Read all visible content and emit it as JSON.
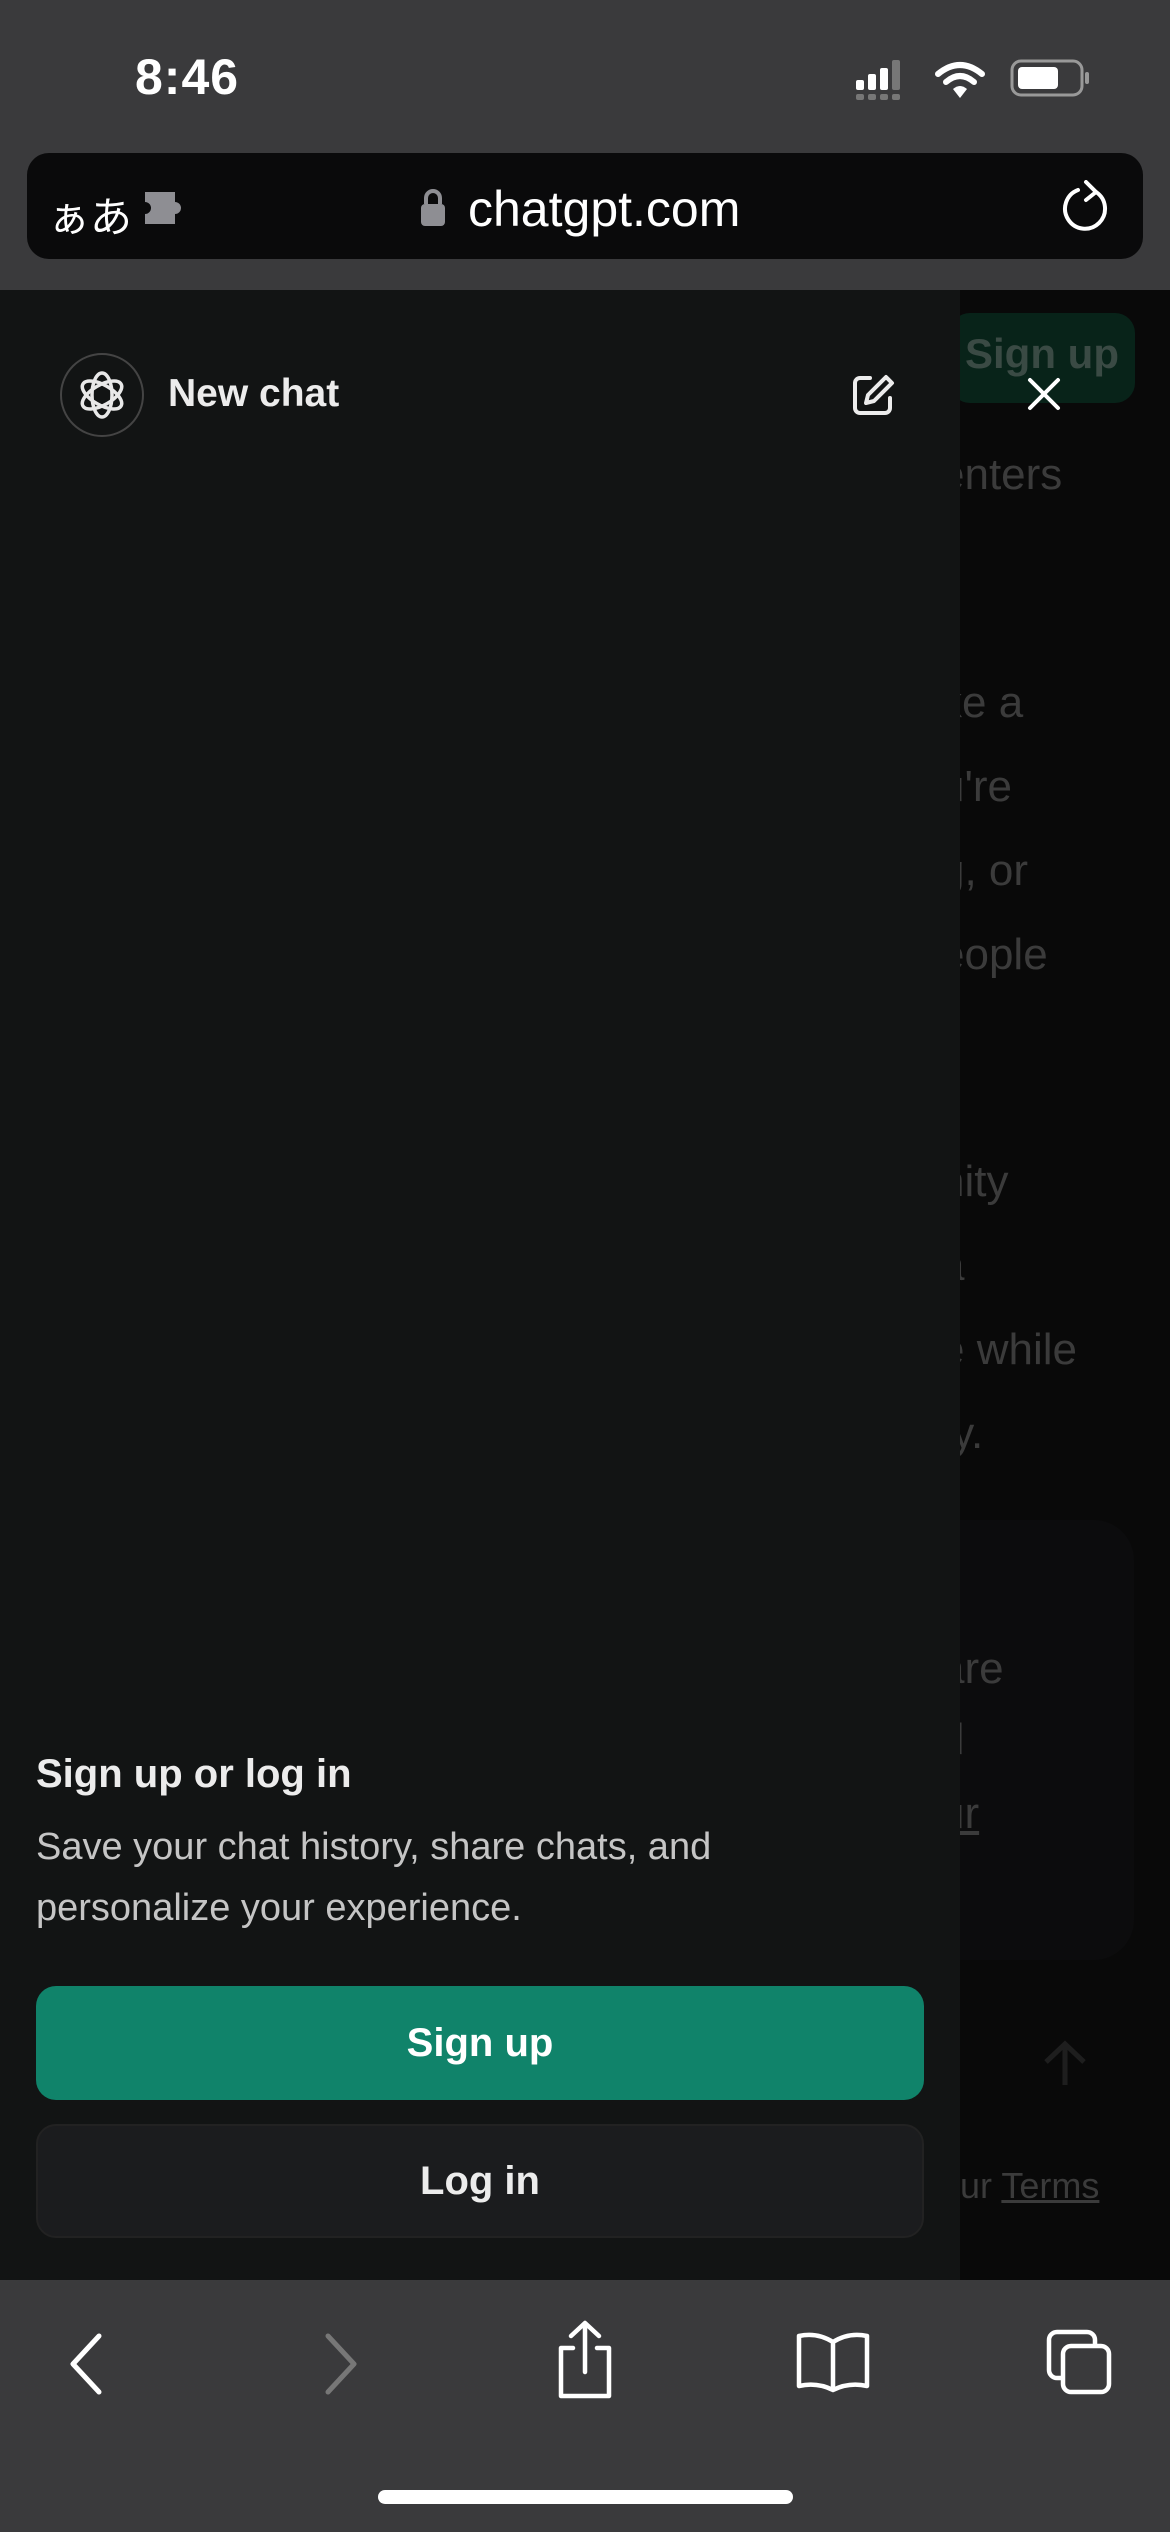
{
  "status_bar": {
    "time": "8:46"
  },
  "browser": {
    "translate_label": "ぁあ",
    "url": "chatgpt.com"
  },
  "background_page": {
    "signup_label": "Sign up",
    "text_fragments": [
      "enters",
      "ke a",
      "u're",
      "g, or",
      "eople",
      "nity",
      "a",
      "e while",
      "ty."
    ],
    "card_fragments": [
      "are",
      "d",
      "ur"
    ],
    "footer_prefix": "our ",
    "footer_link": "Terms"
  },
  "sidebar": {
    "new_chat_label": "New chat",
    "prompt_title": "Sign up or log in",
    "prompt_line1": "Save your chat history, share chats, and",
    "prompt_line2": "personalize your experience.",
    "signup_label": "Sign up",
    "login_label": "Log in",
    "accent_color": "#10836a"
  }
}
